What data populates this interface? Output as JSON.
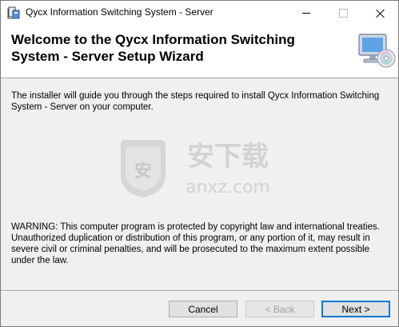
{
  "window": {
    "title": "Qycx Information Switching System - Server",
    "controls": {
      "minimize": "minimize-icon",
      "maximize": "maximize-icon",
      "close": "close-icon"
    }
  },
  "header": {
    "title": "Welcome to the Qycx Information Switching System - Server Setup Wizard",
    "icon": "computer-cd-icon"
  },
  "content": {
    "intro": "The installer will guide you through the steps required to install Qycx Information Switching System - Server on your computer.",
    "warning": "WARNING: This computer program is protected by copyright law and international treaties. Unauthorized duplication or distribution of this program, or any portion of it, may result in severe civil or criminal penalties, and will be prosecuted to the maximum extent possible under the law.",
    "watermark": {
      "cn": "安下载",
      "en": "anxz.com",
      "badge": "安"
    }
  },
  "buttons": {
    "cancel": "Cancel",
    "back": "< Back",
    "next": "Next >"
  },
  "colors": {
    "accent": "#0078d7",
    "watermark": "#d0d0d0"
  }
}
